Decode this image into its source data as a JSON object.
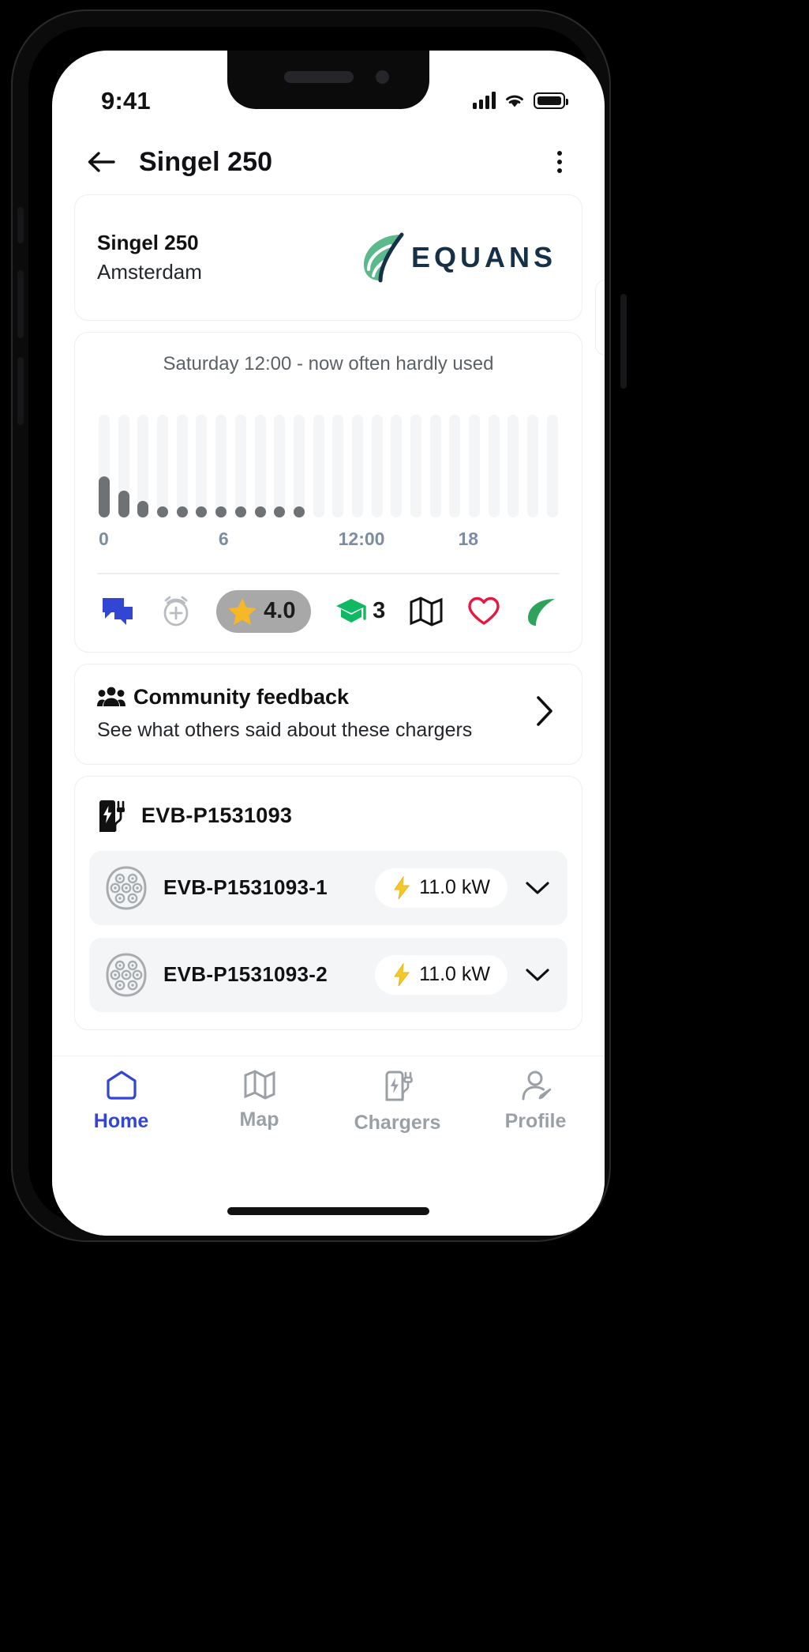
{
  "status_bar": {
    "time": "9:41",
    "signal_icon": "signal-bars-icon",
    "wifi_icon": "wifi-icon",
    "battery_icon": "battery-full-icon"
  },
  "header": {
    "back_icon": "arrow-left-icon",
    "title": "Singel 250",
    "menu_icon": "more-vertical-icon"
  },
  "location_card": {
    "name": "Singel 250",
    "city": "Amsterdam",
    "brand_name": "EQUANS",
    "brand_logo_icon": "equans-leaf-logo-icon",
    "brand_color": "#17304a",
    "leaf_color": "#4caf7d"
  },
  "usage_card": {
    "title": "Saturday 12:00 - now often hardly used",
    "axis_labels": [
      "0",
      "6",
      "12:00",
      "18"
    ],
    "axis_label_color": "#7d8da1",
    "track_color": "#f4f5f6",
    "fill_color": "#6f7275"
  },
  "chart_data": {
    "type": "bar",
    "title": "Saturday 12:00 - now often hardly used",
    "xlabel": "",
    "ylabel": "",
    "categories": [
      "0",
      "1",
      "2",
      "3",
      "4",
      "5",
      "6",
      "7",
      "8",
      "9",
      "10",
      "11",
      "12",
      "13",
      "14",
      "15",
      "16",
      "17",
      "18",
      "19",
      "20",
      "21",
      "22",
      "23"
    ],
    "tick_labels": [
      "0",
      "6",
      "12:00",
      "18"
    ],
    "tick_positions": [
      0,
      6,
      12,
      18
    ],
    "values": [
      40,
      26,
      16,
      11,
      10,
      10,
      10,
      10,
      10,
      10,
      9,
      0,
      0,
      0,
      0,
      0,
      0,
      0,
      0,
      0,
      0,
      0,
      0,
      0
    ],
    "ylim": [
      0,
      100
    ],
    "grid": false,
    "legend_position": "none",
    "bar_track_max": 100
  },
  "action_icons": [
    {
      "name": "chat-bubbles-icon",
      "label": "",
      "color": "#3246d3"
    },
    {
      "name": "alarm-plus-icon",
      "label": "",
      "color": "#b9bcc0"
    },
    {
      "name": "star-rating-pill",
      "label": "4.0",
      "color": "#f6b828",
      "pill_bg": "#a8a8a8"
    },
    {
      "name": "graduation-cap-icon",
      "label": "3",
      "color": "#0fb862"
    },
    {
      "name": "map-icon",
      "label": "",
      "color": "#111111"
    },
    {
      "name": "heart-icon",
      "label": "",
      "color": "#e8173f"
    },
    {
      "name": "leaf-icon",
      "label": "",
      "color": "#2fa35c"
    }
  ],
  "community_card": {
    "icon": "people-group-icon",
    "title": "Community feedback",
    "subtitle": "See what others said about these chargers",
    "chevron_icon": "chevron-right-icon"
  },
  "charger_group": {
    "station_icon": "ev-charging-station-icon",
    "station_id": "EVB-P1531093",
    "connectors": [
      {
        "connector_icon": "type2-connector-icon",
        "id": "EVB-P1531093-1",
        "power_icon": "lightning-bolt-icon",
        "power": "11.0 kW",
        "chevron_icon": "chevron-down-icon"
      },
      {
        "connector_icon": "type2-connector-icon",
        "id": "EVB-P1531093-2",
        "power_icon": "lightning-bolt-icon",
        "power": "11.0 kW",
        "chevron_icon": "chevron-down-icon"
      }
    ]
  },
  "tab_bar": {
    "active_color": "#3246d3",
    "inactive_color": "#9aa0a6",
    "tabs": [
      {
        "icon": "home-icon",
        "label": "Home",
        "active": true
      },
      {
        "icon": "map-icon",
        "label": "Map",
        "active": false
      },
      {
        "icon": "chargers-icon",
        "label": "Chargers",
        "active": false
      },
      {
        "icon": "profile-icon",
        "label": "Profile",
        "active": false
      }
    ]
  }
}
